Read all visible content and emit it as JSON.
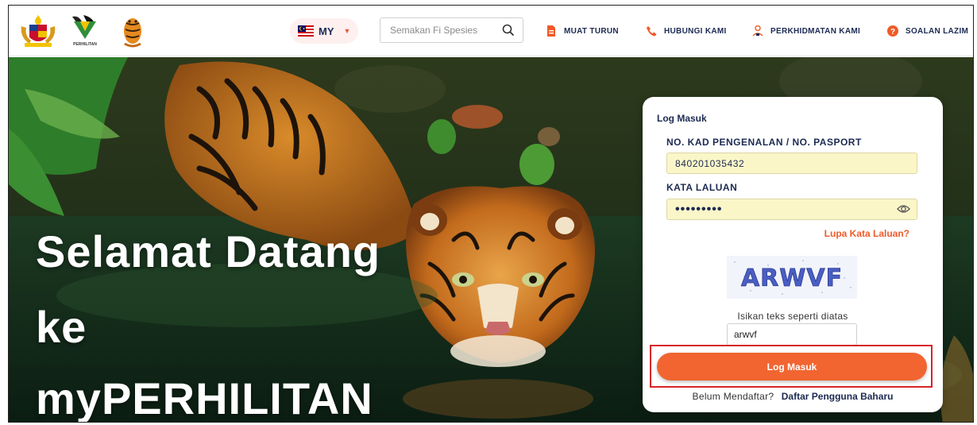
{
  "header": {
    "language": {
      "code": "MY",
      "flag_icon": "malaysia-flag-icon"
    },
    "search": {
      "placeholder": "Semakan Fi Spesies",
      "icon": "search-icon"
    },
    "nav": [
      {
        "label": "MUAT TURUN",
        "icon": "download-file-icon"
      },
      {
        "label": "HUBUNGI KAMI",
        "icon": "phone-icon"
      },
      {
        "label": "PERKHIDMATAN KAMI",
        "icon": "service-person-icon"
      },
      {
        "label": "SOALAN LAZIM",
        "icon": "question-circle-icon"
      }
    ],
    "logos": {
      "perhilitan_text": "PERHILITAN"
    }
  },
  "hero": {
    "welcome_lines": [
      "Selamat Datang",
      "ke",
      "myPERHILITAN"
    ]
  },
  "login": {
    "title": "Log Masuk",
    "id_label": "NO. KAD PENGENALAN / NO. PASPORT",
    "id_value": "840201035432",
    "password_label": "KATA LALUAN",
    "password_value": "•••••••••",
    "forgot_link": "Lupa Kata Laluan?",
    "captcha_text": "ARWVF",
    "captcha_hint": "Isikan teks seperti diatas",
    "captcha_value": "arwvf",
    "submit_label": "Log Masuk",
    "register_question": "Belum Mendaftar?",
    "register_link": "Daftar Pengguna Baharu"
  },
  "colors": {
    "accent_orange": "#f26530",
    "navy_text": "#1c2a52",
    "highlight_red": "#d8232a",
    "input_yellow": "#fbf6c8"
  }
}
